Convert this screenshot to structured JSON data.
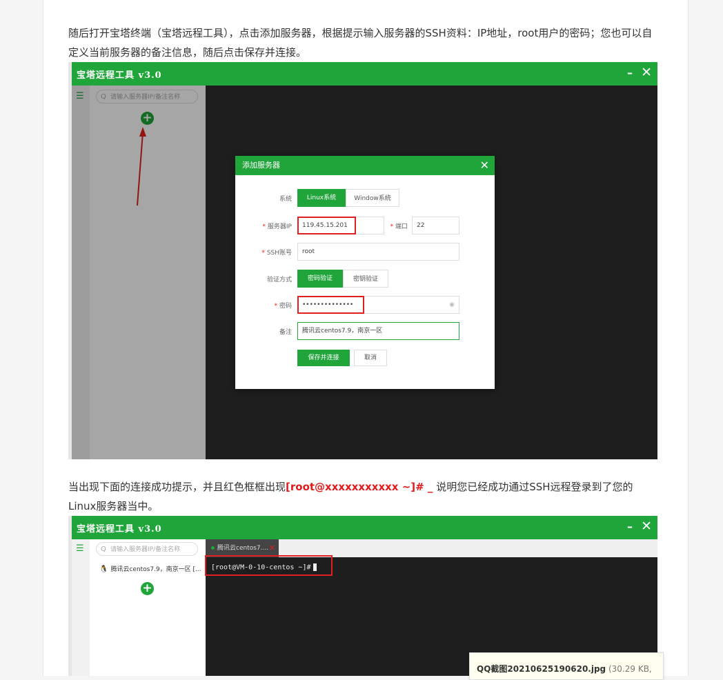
{
  "article": {
    "para1": "随后打开宝塔终端（宝塔远程工具），点击添加服务器，根据提示输入服务器的SSH资料：IP地址，root用户的密码；您也可以自定义当前服务器的备注信息，随后点击保存并连接。",
    "para2_before": "当出现下面的连接成功提示，并且红色框框出现",
    "para2_highlight": "[root@xxxxxxxxxxx ~]# _",
    "para2_after": " 说明您已经成功通过SSH远程登录到了您的Linux服务器当中。"
  },
  "app": {
    "title": "宝塔远程工具 v3.0",
    "minimize": "–",
    "close": "✕",
    "search_placeholder": "请输入服务器IP/备注名称",
    "menu_icon": "☰",
    "search_icon": "Q",
    "add_icon": "+"
  },
  "dialog": {
    "title": "添加服务器",
    "close": "✕",
    "system_label": "系统",
    "system_options": [
      "Linux系统",
      "Window系统"
    ],
    "ip_label": "服务器IP",
    "ip_value": "119.45.15.201",
    "port_label": "端口",
    "port_value": "22",
    "ssh_label": "SSH账号",
    "ssh_value": "root",
    "auth_label": "验证方式",
    "auth_options": [
      "密码验证",
      "密钥验证"
    ],
    "password_label": "密码",
    "password_value": "••••••••••••••",
    "remark_label": "备注",
    "remark_value": "腾讯云centos7.9，南京一区",
    "save_label": "保存并连接",
    "cancel_label": "取消",
    "required_mark": "*",
    "eye_icon": "◉"
  },
  "connected": {
    "server_item": "腾讯云centos7.9，南京一区 [...",
    "tab_label": "腾讯云centos7....",
    "tab_close": "✕",
    "prompt": "[root@VM-0-10-centos ~]#"
  },
  "tooltip": {
    "filename": "QQ截图20210625190620.jpg",
    "meta": "(30.29 KB,"
  },
  "colors": {
    "brand_green": "#20a53a",
    "highlight_red": "#e01b1b"
  }
}
